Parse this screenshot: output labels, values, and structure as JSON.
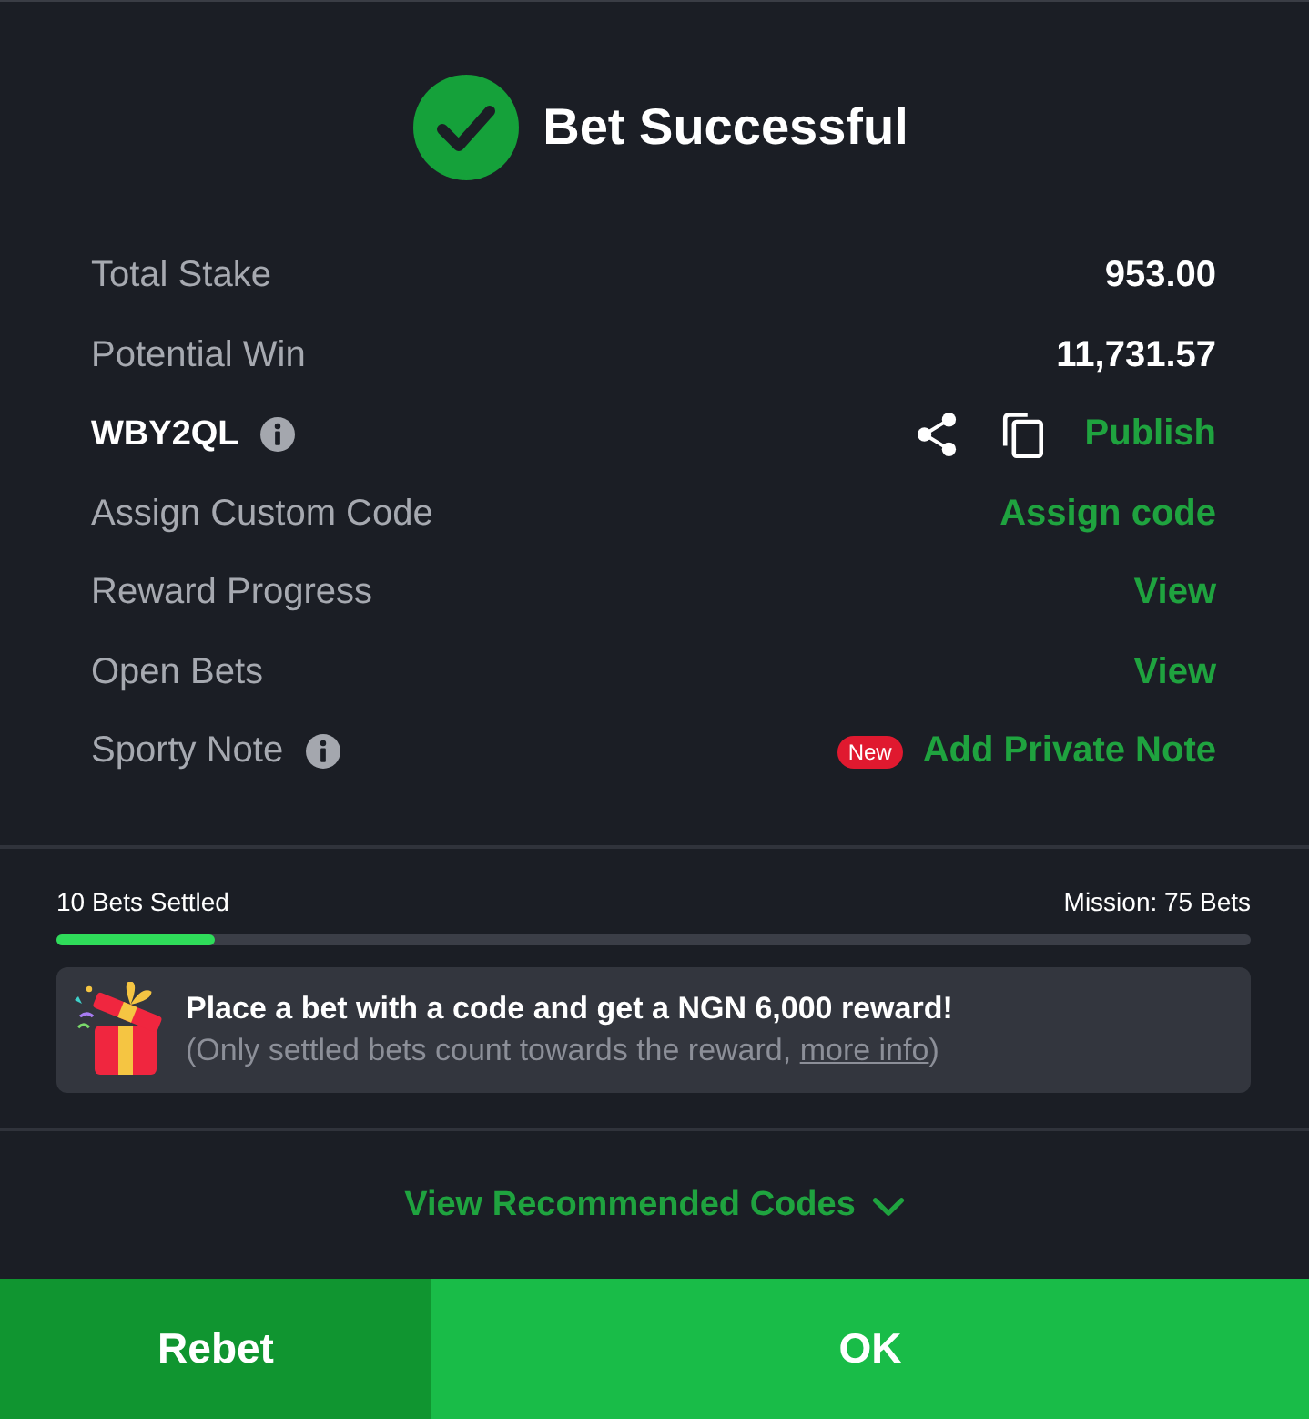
{
  "header": {
    "title": "Bet Successful"
  },
  "details": [
    {
      "kind": "amount",
      "label": "Total Stake",
      "info": false,
      "value": "953.00"
    },
    {
      "kind": "amount",
      "label": "Potential Win",
      "info": false,
      "value": "11,731.57"
    },
    {
      "kind": "code",
      "label": "WBY2QL",
      "info": true,
      "action": "Publish"
    },
    {
      "kind": "link",
      "label": "Assign Custom Code",
      "info": false,
      "action": "Assign code"
    },
    {
      "kind": "link",
      "label": "Reward Progress",
      "info": false,
      "action": "View"
    },
    {
      "kind": "link",
      "label": "Open Bets",
      "info": false,
      "action": "View"
    },
    {
      "kind": "link",
      "label": "Sporty Note",
      "info": true,
      "badge": "New",
      "action": "Add Private Note"
    }
  ],
  "progress": {
    "settled": "10 Bets Settled",
    "mission": "Mission: 75 Bets",
    "level": 0.133
  },
  "promo": {
    "headline": "Place a bet with a code and get a NGN 6,000 reward!",
    "note_before": "(Only settled bets count towards the reward, ",
    "link": "more info",
    "note_after": ")"
  },
  "recommended": {
    "label": "View Recommended Codes",
    "expanded": false
  },
  "buttons": [
    {
      "kind": "secondary",
      "label": "Rebet"
    },
    {
      "kind": "primary",
      "label": "OK"
    }
  ]
}
